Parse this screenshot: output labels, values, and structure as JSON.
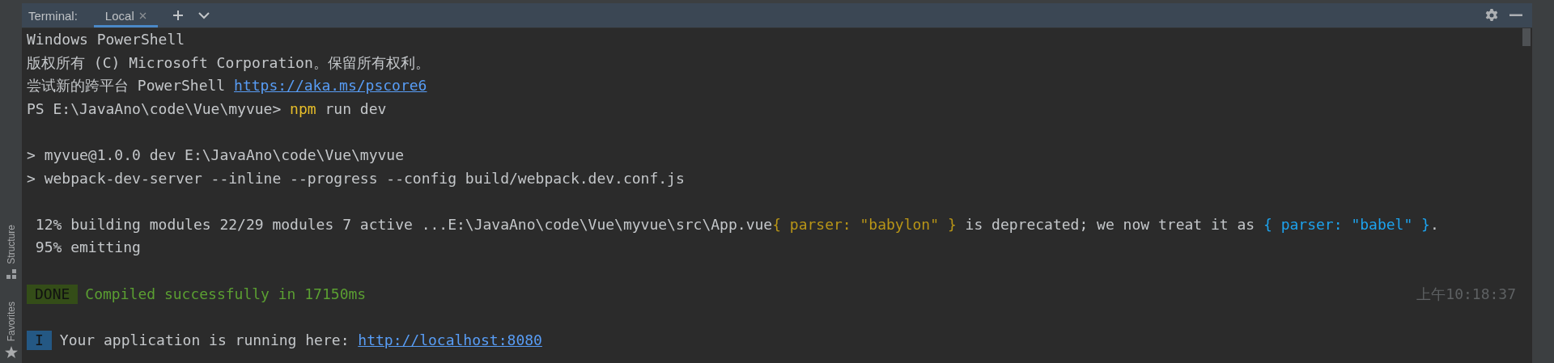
{
  "sidebar": {
    "items": [
      {
        "label": "Structure"
      },
      {
        "label": "Favorites"
      }
    ]
  },
  "toolbar": {
    "title": "Terminal:",
    "tabs": [
      {
        "label": "Local",
        "selected": true
      }
    ]
  },
  "terminal": {
    "lines": [
      {
        "kind": "text",
        "segments": [
          {
            "kind": "plain",
            "text": "Windows PowerShell"
          }
        ]
      },
      {
        "kind": "text",
        "segments": [
          {
            "kind": "plain",
            "text": "版权所有 (C) Microsoft Corporation。保留所有权利。"
          }
        ]
      },
      {
        "kind": "text",
        "segments": [
          {
            "kind": "plain",
            "text": "尝试新的跨平台 PowerShell "
          },
          {
            "kind": "link",
            "text": "https://aka.ms/pscore6"
          }
        ]
      },
      {
        "kind": "text",
        "segments": [
          {
            "kind": "plain",
            "text": "PS E:\\JavaAno\\code\\Vue\\myvue> "
          },
          {
            "kind": "command",
            "text": "npm"
          },
          {
            "kind": "plain",
            "text": " run dev"
          }
        ]
      },
      {
        "kind": "blank"
      },
      {
        "kind": "text",
        "segments": [
          {
            "kind": "plain",
            "text": "> myvue@1.0.0 dev E:\\JavaAno\\code\\Vue\\myvue"
          }
        ]
      },
      {
        "kind": "text",
        "segments": [
          {
            "kind": "plain",
            "text": "> webpack-dev-server --inline --progress --config build/webpack.dev.conf.js"
          }
        ]
      },
      {
        "kind": "blank"
      },
      {
        "kind": "text",
        "segments": [
          {
            "kind": "plain",
            "text": " 12% building modules 22/29 modules 7 active ...E:\\JavaAno\\code\\Vue\\myvue\\src\\App.vue"
          },
          {
            "kind": "warn",
            "text": "{ parser: \"babylon\" }"
          },
          {
            "kind": "plain",
            "text": " is deprecated; we now treat it as "
          },
          {
            "kind": "info",
            "text": "{ parser: \"babel\" }"
          },
          {
            "kind": "plain",
            "text": "."
          }
        ]
      },
      {
        "kind": "text",
        "segments": [
          {
            "kind": "plain",
            "text": " 95% emitting"
          }
        ]
      },
      {
        "kind": "blank"
      },
      {
        "kind": "text",
        "segments": [
          {
            "kind": "badge_done",
            "text": "DONE"
          },
          {
            "kind": "success",
            "text": "Compiled successfully in 17150ms"
          }
        ],
        "time": "上午10:18:37"
      },
      {
        "kind": "blank"
      },
      {
        "kind": "text",
        "segments": [
          {
            "kind": "badge_info",
            "text": "I"
          },
          {
            "kind": "plain",
            "text": "Your application is running here: "
          },
          {
            "kind": "link",
            "text": "http://localhost:8080"
          }
        ]
      }
    ]
  }
}
